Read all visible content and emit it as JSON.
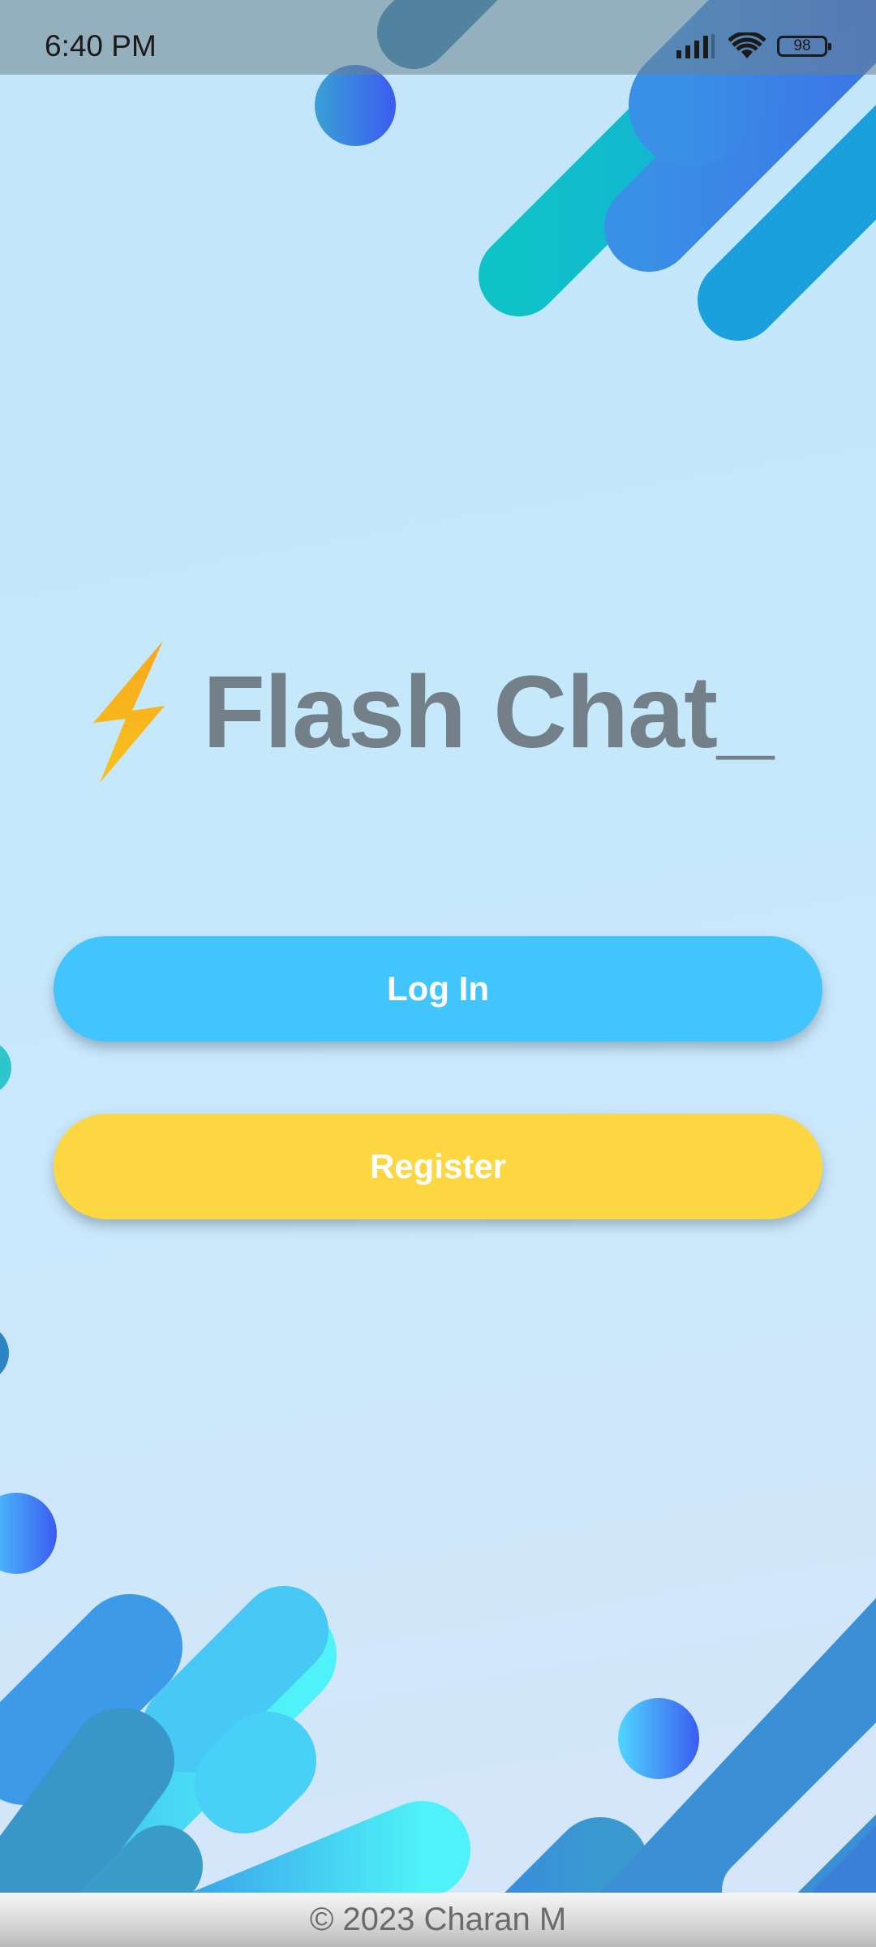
{
  "status_bar": {
    "time": "6:40 PM",
    "battery": "98",
    "icons": [
      "signal-icon",
      "wifi-icon",
      "battery-icon"
    ]
  },
  "app": {
    "title": "Flash Chat_",
    "logo_icon": "lightning-bolt-icon"
  },
  "buttons": {
    "login_label": "Log In",
    "register_label": "Register"
  },
  "footer": {
    "text": "© 2023 Charan M"
  },
  "colors": {
    "background": "#c6e8fb",
    "login_button": "#42c4fc",
    "register_button": "#fdd741",
    "title_text": "#737f89",
    "bolt": "#f8b21d"
  }
}
